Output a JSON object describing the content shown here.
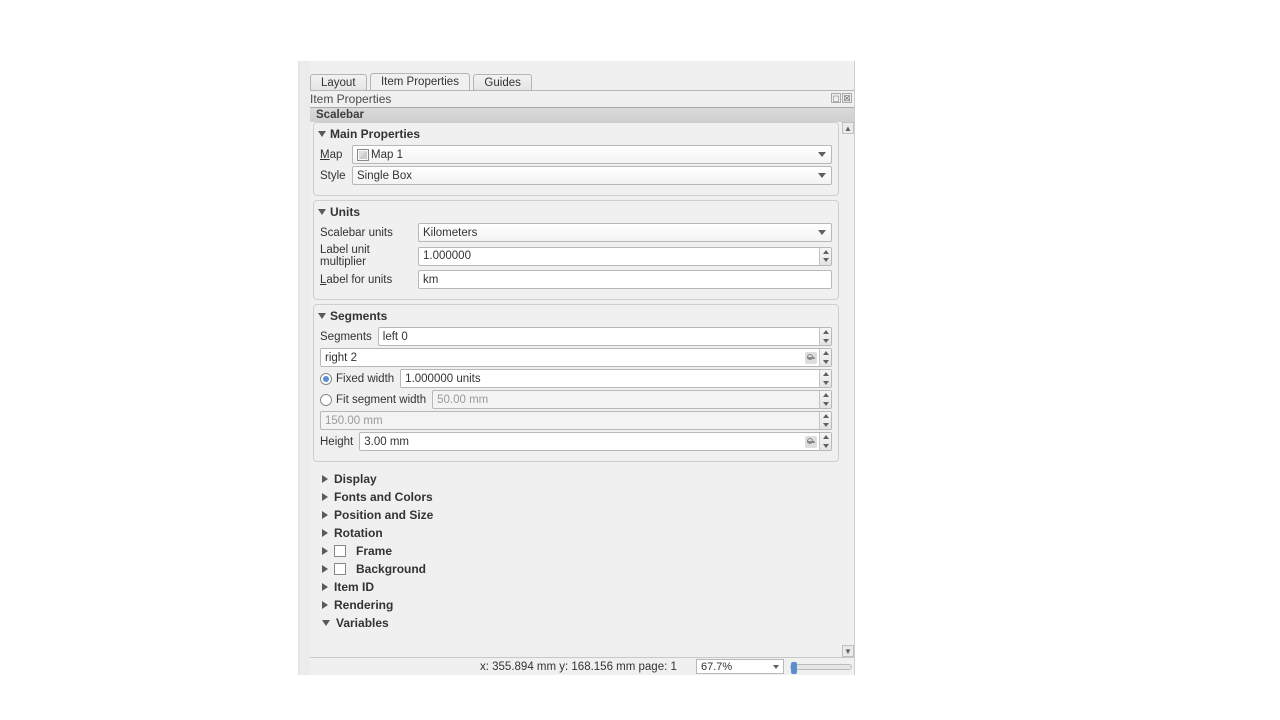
{
  "tabs": {
    "layout": "Layout",
    "item_properties": "Item Properties",
    "guides": "Guides"
  },
  "panel_title": "Item Properties",
  "item_type": "Scalebar",
  "main_properties": {
    "header": "Main Properties",
    "map_label": "ap",
    "map_value": "Map 1",
    "style_label": "Style",
    "style_value": "Single Box"
  },
  "units": {
    "header": "Units",
    "scalebar_units_label": "Scalebar units",
    "scalebar_units_value": "Kilometers",
    "multiplier_label": "Label unit multiplier",
    "multiplier_value": "1.000000",
    "label_for_units_label": "abel for units",
    "label_for_units_value": "km"
  },
  "segments": {
    "header": "Segments",
    "segments_label": "Segments",
    "left_value": "left 0",
    "right_value": "right 2",
    "fixed_width_label": "Fixed width",
    "fit_segment_label": "Fit segment width",
    "fixed_value": "1.000000 units",
    "fit_min": "50.00 mm",
    "fit_max": "150.00 mm",
    "height_label": "Height",
    "height_value": "3.00 mm"
  },
  "collapsed": {
    "display": "Display",
    "fonts": "Fonts and Colors",
    "position": "Position and Size",
    "rotation": "Rotation",
    "frame": "Frame",
    "background": "Background",
    "item_id": "Item ID",
    "rendering": "Rendering",
    "variables": "Variables"
  },
  "status": {
    "coords": "x: 355.894 mm y: 168.156 mm page: 1",
    "zoom": "67.7%"
  }
}
